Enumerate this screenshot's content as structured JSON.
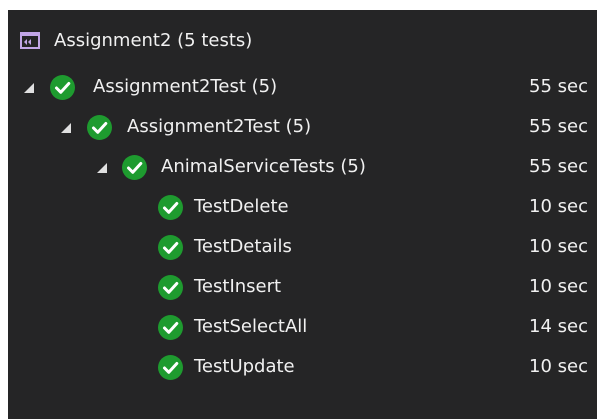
{
  "header": {
    "title": "Assignment2 (5 tests)",
    "icon": "project-icon"
  },
  "colors": {
    "background": "#252526",
    "text": "#f1f1f1",
    "passed": "#1e9b2f",
    "project_icon": "#c3a7e8",
    "expander": "#e0e0e0"
  },
  "tree": [
    {
      "label": "Assignment2Test (5)",
      "duration": "55 sec",
      "status": "passed",
      "expanded": true,
      "level": 0
    },
    {
      "label": "Assignment2Test (5)",
      "duration": "55 sec",
      "status": "passed",
      "expanded": true,
      "level": 1
    },
    {
      "label": "AnimalServiceTests (5)",
      "duration": "55 sec",
      "status": "passed",
      "expanded": true,
      "level": 2
    },
    {
      "label": "TestDelete",
      "duration": "10 sec",
      "status": "passed",
      "level": 3
    },
    {
      "label": "TestDetails",
      "duration": "10 sec",
      "status": "passed",
      "level": 3
    },
    {
      "label": "TestInsert",
      "duration": "10 sec",
      "status": "passed",
      "level": 3
    },
    {
      "label": "TestSelectAll",
      "duration": "14 sec",
      "status": "passed",
      "level": 3
    },
    {
      "label": "TestUpdate",
      "duration": "10 sec",
      "status": "passed",
      "level": 3
    }
  ]
}
